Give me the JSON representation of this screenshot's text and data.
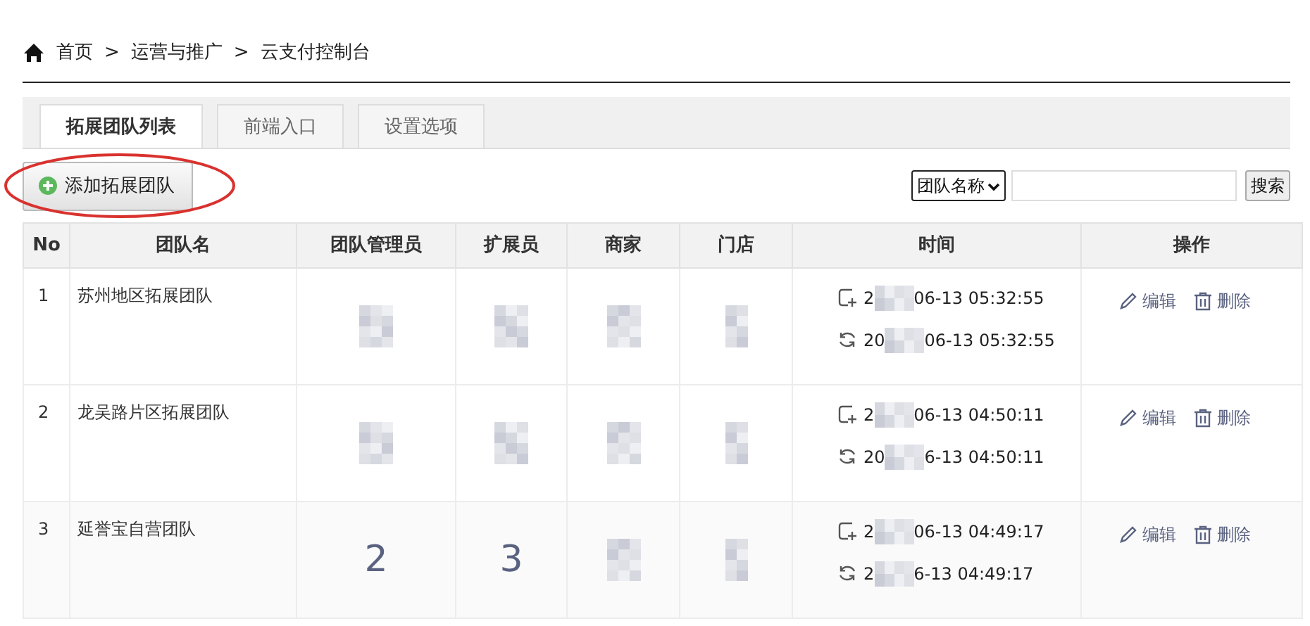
{
  "breadcrumb": [
    "首页",
    "运营与推广",
    "云支付控制台"
  ],
  "breadcrumb_separator": ">",
  "tabs": [
    {
      "label": "拓展团队列表",
      "selected": true
    },
    {
      "label": "前端入口",
      "selected": false
    },
    {
      "label": "设置选项",
      "selected": false
    }
  ],
  "add_button": {
    "label": "添加拓展团队",
    "highlighted": true
  },
  "search": {
    "field_select": "团队名称",
    "button": "搜索"
  },
  "table": {
    "columns": [
      "No",
      "团队名",
      "团队管理员",
      "扩展员",
      "商家",
      "门店",
      "时间",
      "操作"
    ],
    "rows": [
      {
        "no": "1",
        "name": "苏州地区拓展团队",
        "counts": [
          {
            "kind": "blurred"
          },
          {
            "kind": "blurred"
          },
          {
            "kind": "blurred"
          },
          {
            "kind": "blurred"
          }
        ],
        "created": [
          "2",
          "06-13 05:32:55"
        ],
        "updated": [
          "20",
          "06-13 05:32:55"
        ],
        "actions": [
          "编辑",
          "删除"
        ]
      },
      {
        "no": "2",
        "name": "龙吴路片区拓展团队",
        "counts": [
          {
            "kind": "blurred"
          },
          {
            "kind": "blurred"
          },
          {
            "kind": "blurred"
          },
          {
            "kind": "blurred"
          }
        ],
        "created": [
          "2",
          "06-13 04:50:11"
        ],
        "updated": [
          "20",
          "6-13 04:50:11"
        ],
        "actions": [
          "编辑",
          "删除"
        ]
      },
      {
        "no": "3",
        "name": "延誉宝自营团队",
        "counts": [
          {
            "kind": "number",
            "value": "2"
          },
          {
            "kind": "number",
            "value": "3"
          },
          {
            "kind": "blurred"
          },
          {
            "kind": "blurred"
          }
        ],
        "created": [
          "2",
          "06-13 04:49:17"
        ],
        "updated": [
          "2",
          "6-13 04:49:17"
        ],
        "actions": [
          "编辑",
          "删除"
        ]
      }
    ]
  }
}
